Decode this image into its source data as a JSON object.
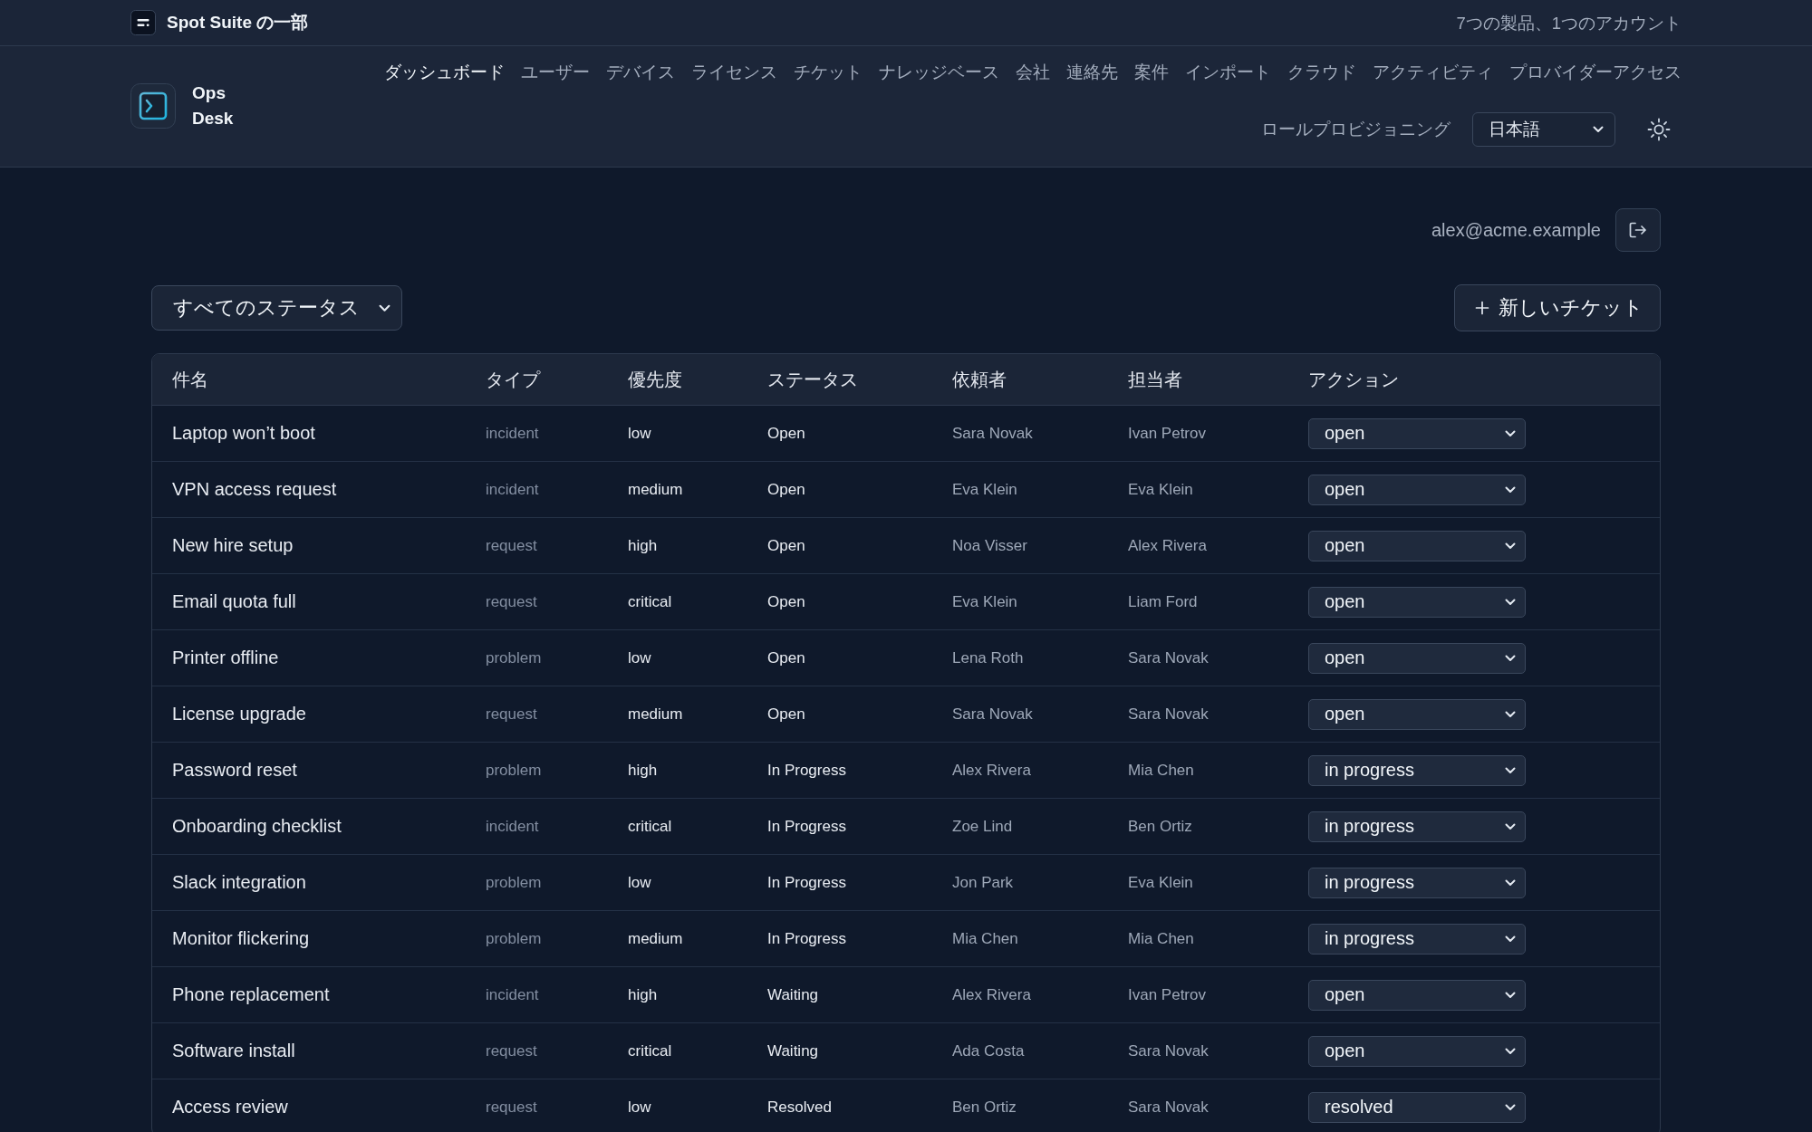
{
  "suite_bar": {
    "label": "Spot Suite の一部",
    "tagline": "7つの製品、1つのアカウント"
  },
  "app": {
    "name": "Ops Desk"
  },
  "nav": {
    "items": [
      {
        "label": "ダッシュボード",
        "selected": true
      },
      {
        "label": "ユーザー",
        "selected": false
      },
      {
        "label": "デバイス",
        "selected": false
      },
      {
        "label": "ライセンス",
        "selected": false
      },
      {
        "label": "チケット",
        "selected": false
      },
      {
        "label": "ナレッジベース",
        "selected": false
      },
      {
        "label": "会社",
        "selected": false
      },
      {
        "label": "連絡先",
        "selected": false
      },
      {
        "label": "案件",
        "selected": false
      },
      {
        "label": "インポート",
        "selected": false
      },
      {
        "label": "クラウド",
        "selected": false
      },
      {
        "label": "アクティビティ",
        "selected": false
      },
      {
        "label": "プロバイダーアクセス",
        "selected": false
      },
      {
        "label": "ロールプロビジョニング",
        "selected": false
      }
    ]
  },
  "language_select": {
    "value": "日本語"
  },
  "user": {
    "email": "alex@acme.example"
  },
  "toolbar": {
    "status_filter": {
      "value": "すべてのステータス"
    },
    "new_ticket_button": {
      "label": "新しいチケット"
    }
  },
  "table": {
    "columns": [
      "件名",
      "タイプ",
      "優先度",
      "ステータス",
      "依頼者",
      "担当者",
      "アクション"
    ],
    "rows": [
      {
        "title": "Laptop won’t boot",
        "type": "incident",
        "priority": "low",
        "status": "Open",
        "requester": "Sara Novak",
        "assignee": "Ivan Petrov",
        "action": "open"
      },
      {
        "title": "VPN access request",
        "type": "incident",
        "priority": "medium",
        "status": "Open",
        "requester": "Eva Klein",
        "assignee": "Eva Klein",
        "action": "open"
      },
      {
        "title": "New hire setup",
        "type": "request",
        "priority": "high",
        "status": "Open",
        "requester": "Noa Visser",
        "assignee": "Alex Rivera",
        "action": "open"
      },
      {
        "title": "Email quota full",
        "type": "request",
        "priority": "critical",
        "status": "Open",
        "requester": "Eva Klein",
        "assignee": "Liam Ford",
        "action": "open"
      },
      {
        "title": "Printer offline",
        "type": "problem",
        "priority": "low",
        "status": "Open",
        "requester": "Lena Roth",
        "assignee": "Sara Novak",
        "action": "open"
      },
      {
        "title": "License upgrade",
        "type": "request",
        "priority": "medium",
        "status": "Open",
        "requester": "Sara Novak",
        "assignee": "Sara Novak",
        "action": "open"
      },
      {
        "title": "Password reset",
        "type": "problem",
        "priority": "high",
        "status": "In Progress",
        "requester": "Alex Rivera",
        "assignee": "Mia Chen",
        "action": "in progress"
      },
      {
        "title": "Onboarding checklist",
        "type": "incident",
        "priority": "critical",
        "status": "In Progress",
        "requester": "Zoe Lind",
        "assignee": "Ben Ortiz",
        "action": "in progress"
      },
      {
        "title": "Slack integration",
        "type": "problem",
        "priority": "low",
        "status": "In Progress",
        "requester": "Jon Park",
        "assignee": "Eva Klein",
        "action": "in progress"
      },
      {
        "title": "Monitor flickering",
        "type": "problem",
        "priority": "medium",
        "status": "In Progress",
        "requester": "Mia Chen",
        "assignee": "Mia Chen",
        "action": "in progress"
      },
      {
        "title": "Phone replacement",
        "type": "incident",
        "priority": "high",
        "status": "Waiting",
        "requester": "Alex Rivera",
        "assignee": "Ivan Petrov",
        "action": "open"
      },
      {
        "title": "Software install",
        "type": "request",
        "priority": "critical",
        "status": "Waiting",
        "requester": "Ada Costa",
        "assignee": "Sara Novak",
        "action": "open"
      },
      {
        "title": "Access review",
        "type": "request",
        "priority": "low",
        "status": "Resolved",
        "requester": "Ben Ortiz",
        "assignee": "Sara Novak",
        "action": "resolved"
      }
    ]
  }
}
